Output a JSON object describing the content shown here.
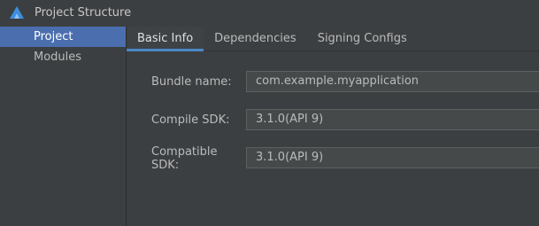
{
  "window": {
    "title": "Project Structure",
    "app_icon": "huawei-deveco-icon"
  },
  "sidebar": {
    "items": [
      {
        "label": "Project",
        "selected": true
      },
      {
        "label": "Modules",
        "selected": false
      }
    ]
  },
  "tabs": [
    {
      "label": "Basic Info",
      "active": true
    },
    {
      "label": "Dependencies",
      "active": false
    },
    {
      "label": "Signing Configs",
      "active": false
    }
  ],
  "form": {
    "bundle_name": {
      "label": "Bundle name:",
      "value": "com.example.myapplication"
    },
    "compile_sdk": {
      "label": "Compile SDK:",
      "value": "3.1.0(API 9)"
    },
    "compatible_sdk": {
      "label": "Compatible SDK:",
      "value": "3.1.0(API 9)"
    }
  },
  "colors": {
    "background": "#3c3f41",
    "selection": "#4b6eaf",
    "tab_underline": "#4a88c7",
    "field_bg": "#45494a"
  }
}
